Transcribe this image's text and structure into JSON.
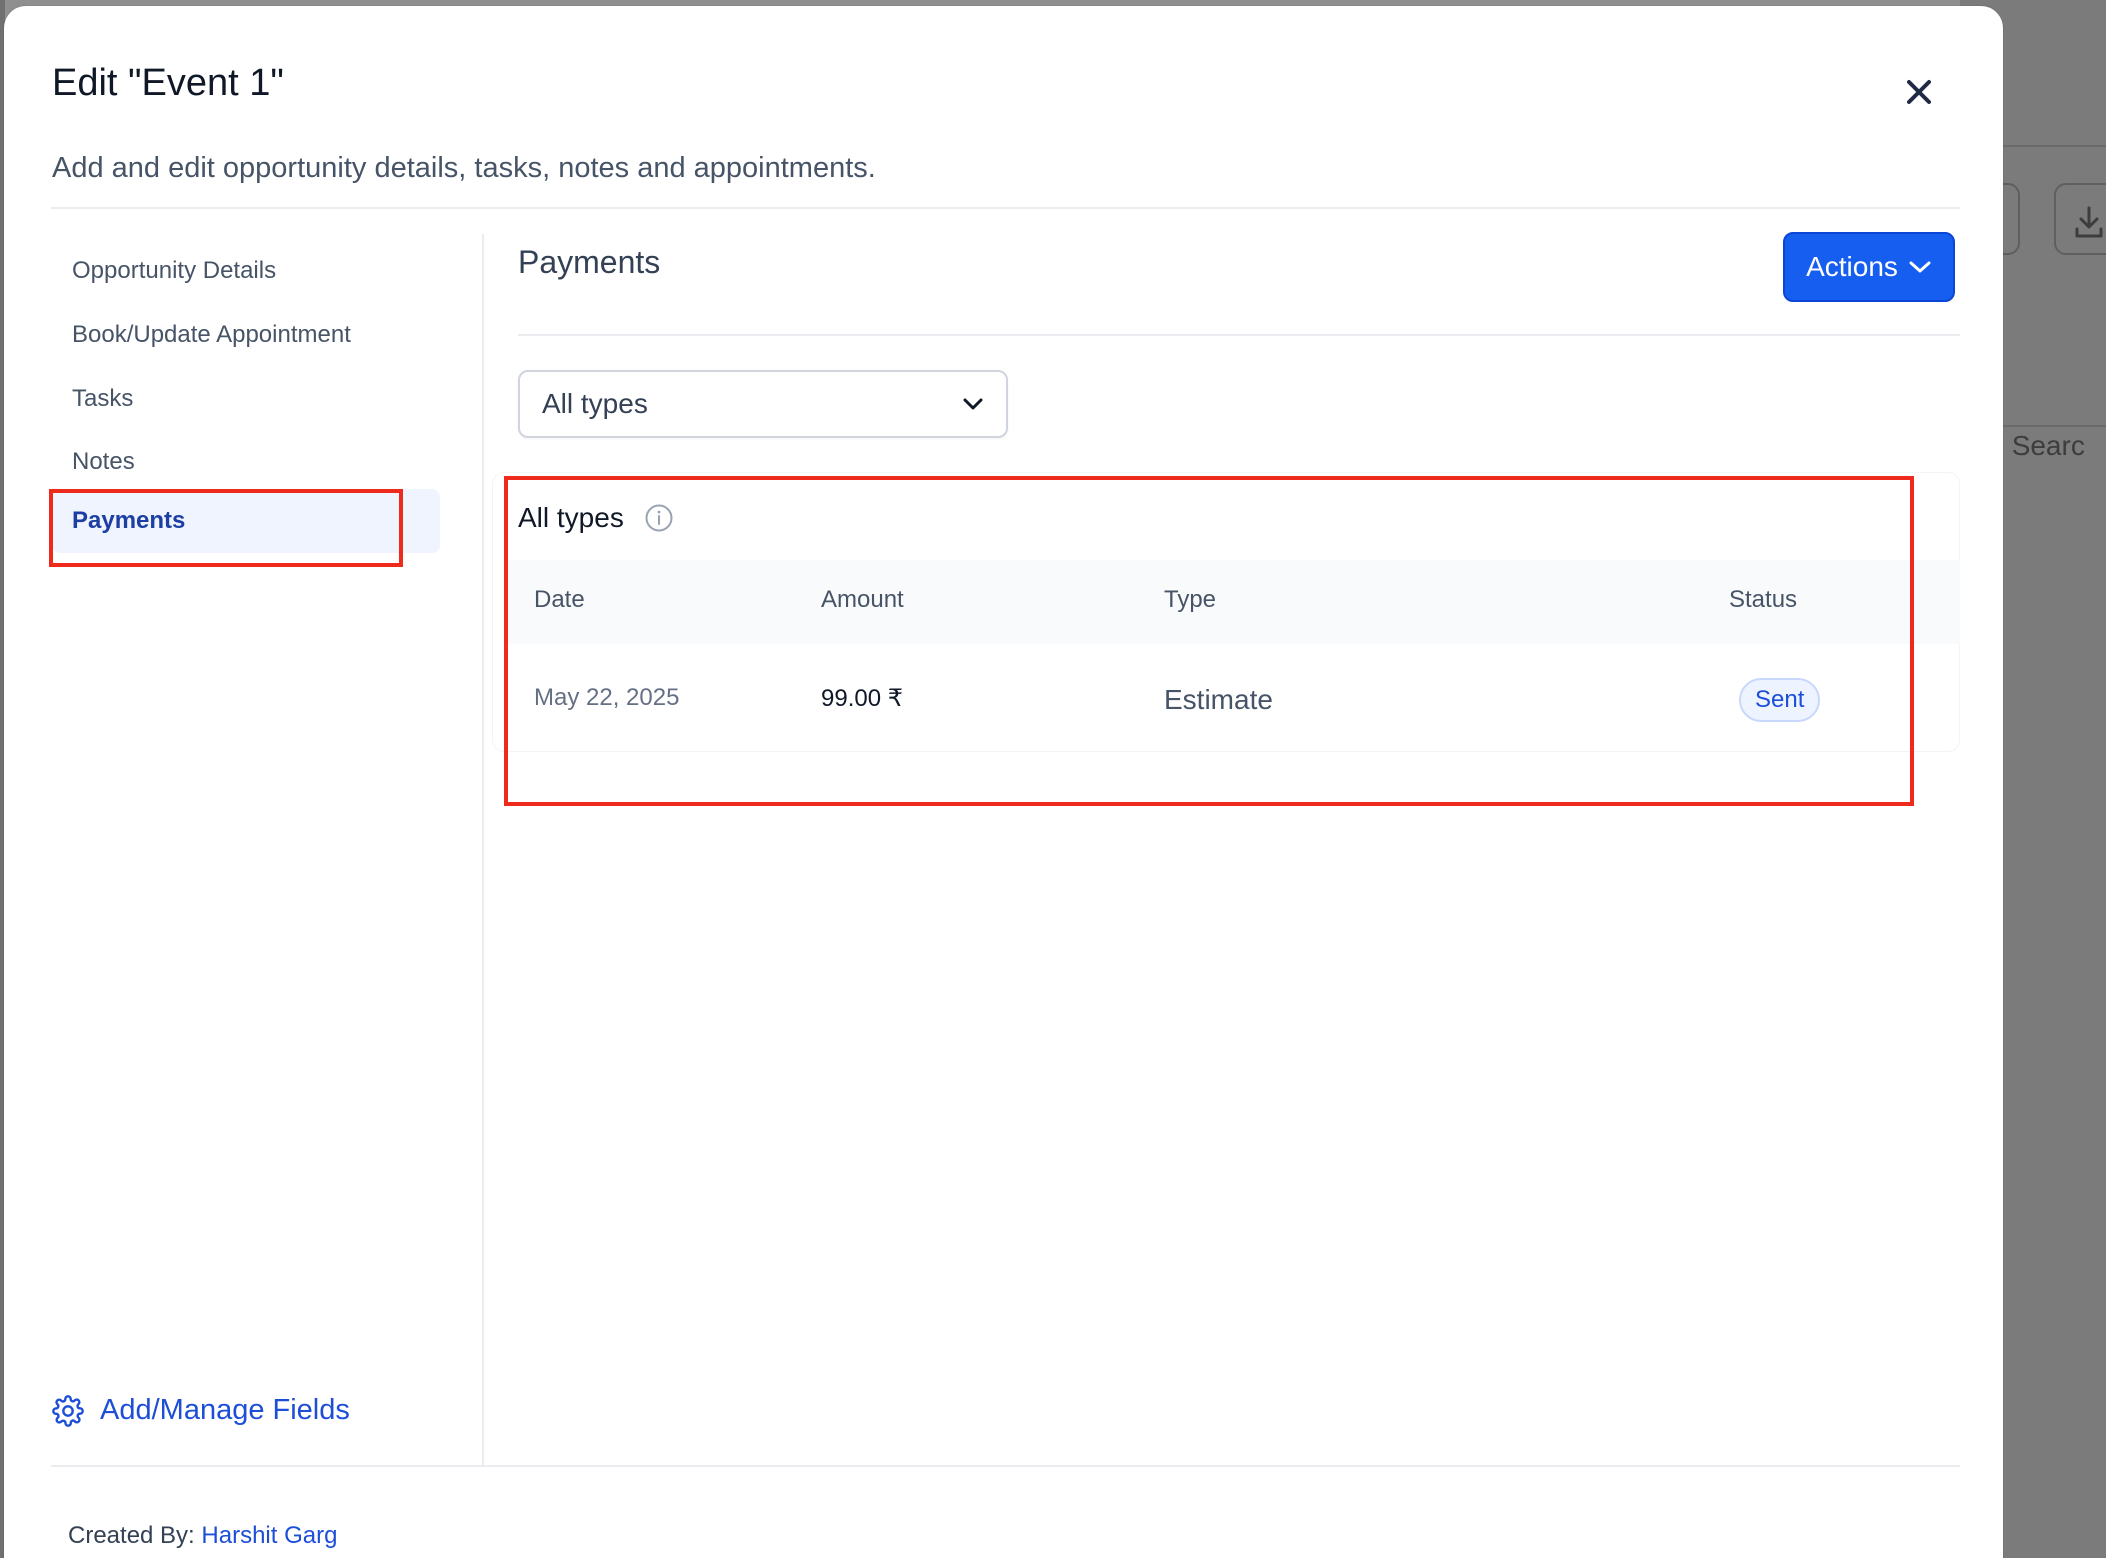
{
  "modal": {
    "title": "Edit \"Event 1\"",
    "subtitle": "Add and edit opportunity details, tasks, notes and appointments."
  },
  "sidebar": {
    "items": [
      {
        "label": "Opportunity Details",
        "active": false
      },
      {
        "label": "Book/Update Appointment",
        "active": false
      },
      {
        "label": "Tasks",
        "active": false
      },
      {
        "label": "Notes",
        "active": false
      },
      {
        "label": "Payments",
        "active": true
      }
    ],
    "manage_fields_label": "Add/Manage Fields"
  },
  "footer": {
    "created_by_label": "Created By:",
    "created_by_name": "Harshit Garg"
  },
  "content": {
    "section_title": "Payments",
    "actions_label": "Actions",
    "filter": {
      "selected": "All types"
    },
    "card": {
      "title": "All types",
      "columns": [
        "Date",
        "Amount",
        "Type",
        "Status"
      ],
      "rows": [
        {
          "date": "May 22, 2025",
          "amount": "99.00 ₹",
          "type": "Estimate",
          "status": "Sent"
        }
      ]
    }
  },
  "background": {
    "search_label": "Searc"
  },
  "colors": {
    "accent": "#155eef",
    "active_nav_bg": "#eff4ff",
    "highlight_box": "#ee2a1c",
    "badge_bg": "#eef4ff"
  }
}
